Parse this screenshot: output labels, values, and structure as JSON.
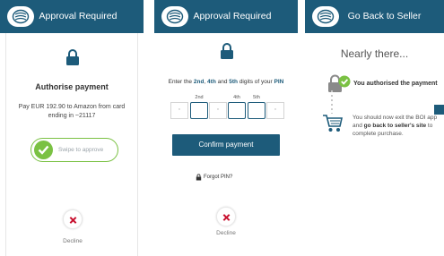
{
  "colors": {
    "header": "#1d5b7a",
    "approve_green": "#7ac143",
    "decline_red": "#c8102e",
    "confirm_button": "#1d5b7a"
  },
  "screen1": {
    "title": "Approval Required",
    "heading": "Authorise payment",
    "payment_text": "Pay EUR 192.90 to Amazon from card ending in ~21117",
    "swipe_label": "Swipe to approve",
    "decline_label": "Decline",
    "icons": [
      "boi-logo-icon",
      "lock-icon",
      "check-icon",
      "close-icon"
    ]
  },
  "screen2": {
    "title": "Approval Required",
    "instruction_parts": [
      "Enter the ",
      "2nd",
      ", ",
      "4th",
      " and ",
      "5th",
      " digits of your ",
      "PIN"
    ],
    "pin_hints": [
      "2nd",
      "4th",
      "5th"
    ],
    "pin_mask": [
      "*",
      "*",
      "*"
    ],
    "confirm_label": "Confirm payment",
    "forgot_label": "Forgot PIN?",
    "decline_label": "Decline"
  },
  "screen3": {
    "title": "Go Back to Seller",
    "heading": "Nearly there...",
    "authorised_text": "You authorised the payment",
    "exit_text_parts": [
      "You should now exit the BOI app and ",
      "go back to seller's site",
      " to complete purchase."
    ]
  }
}
